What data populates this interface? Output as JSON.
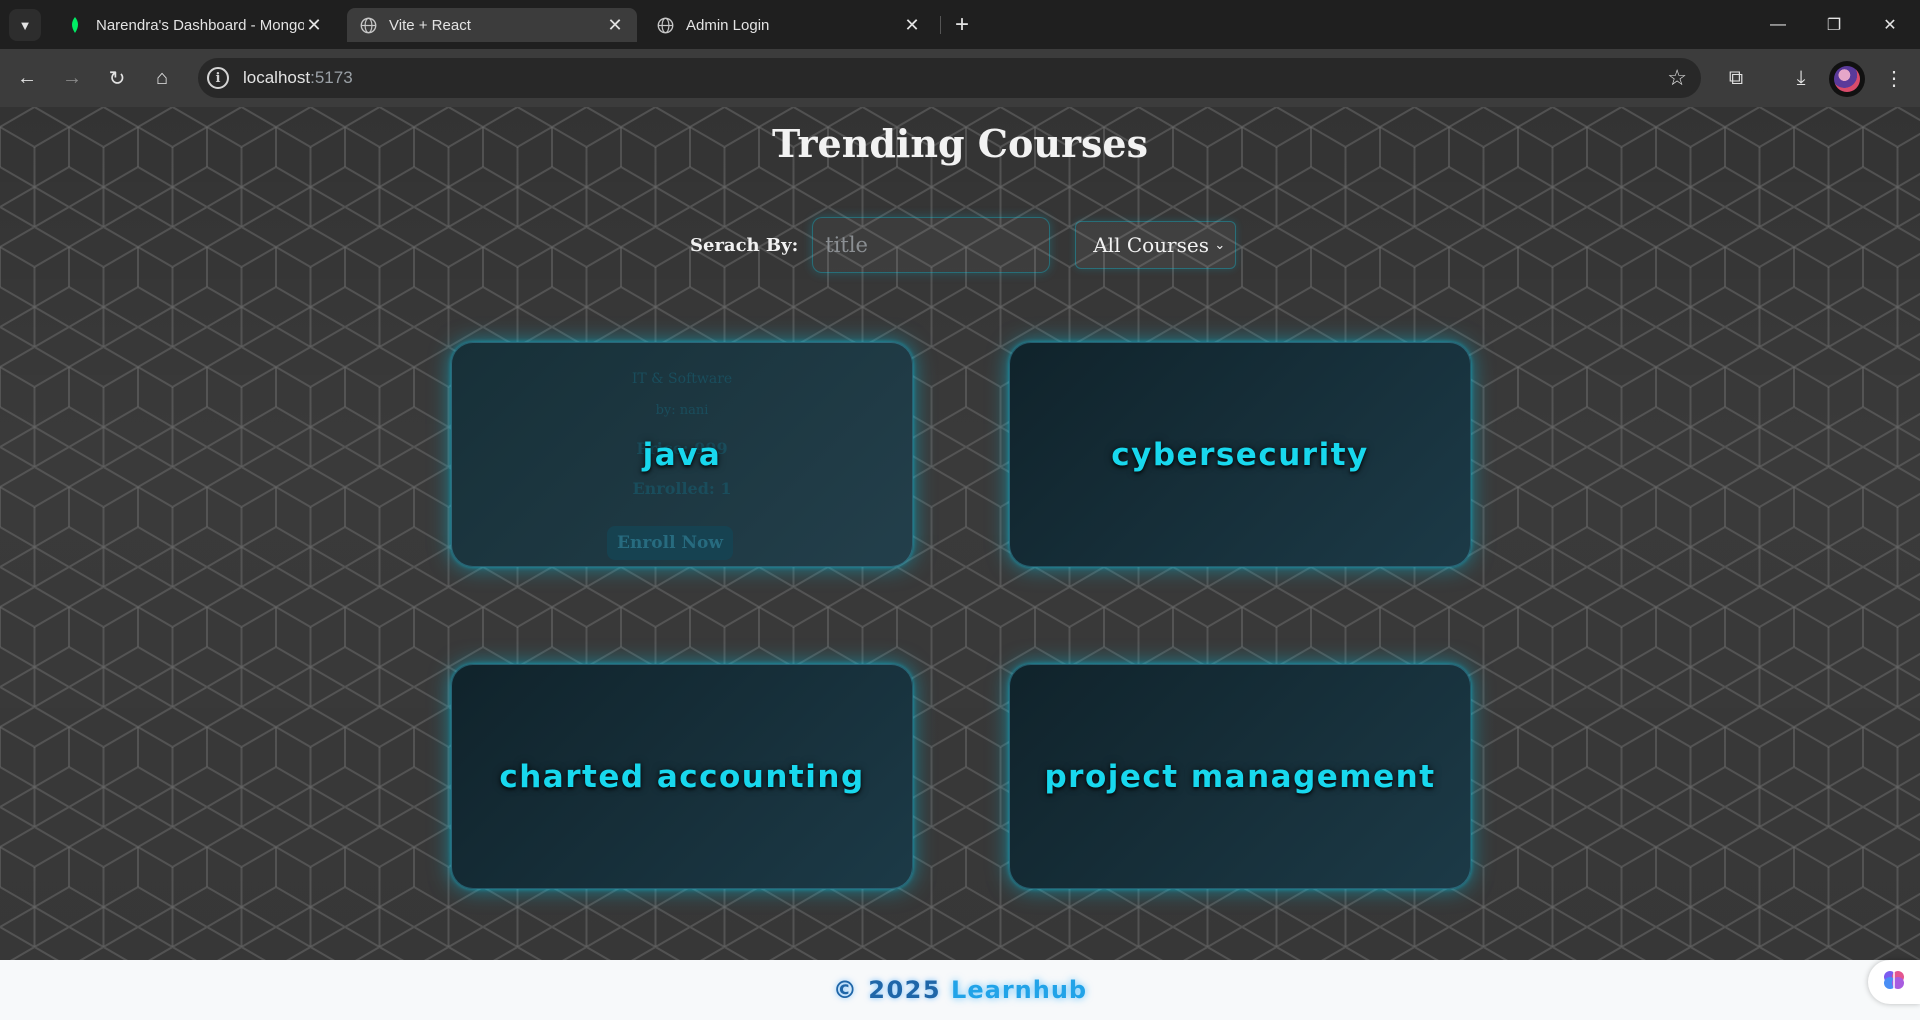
{
  "browser": {
    "tabs": [
      {
        "title": "Narendra's Dashboard - MongoDB",
        "active": false
      },
      {
        "title": "Vite + React",
        "active": true
      },
      {
        "title": "Admin Login",
        "active": false
      }
    ],
    "url_host": "localhost",
    "url_port": ":5173"
  },
  "page": {
    "title": "Trending Courses",
    "search_label": "Serach By:",
    "search_placeholder": "title",
    "search_value": "",
    "filter_selected": "All Courses"
  },
  "courses": [
    {
      "name": "java",
      "category": "IT & Software",
      "by": "by: nani",
      "price": "Price: 999",
      "enrolled": "Enrolled: 1",
      "button": "Enroll Now"
    },
    {
      "name": "cybersecurity"
    },
    {
      "name": "charted accounting"
    },
    {
      "name": "project management"
    }
  ],
  "footer": {
    "copyright": "© 2025",
    "brand": "Learnhub"
  },
  "colors": {
    "accent": "#18d8ee",
    "footer_text": "#1f66a8",
    "footer_brand": "#21a3e8"
  }
}
